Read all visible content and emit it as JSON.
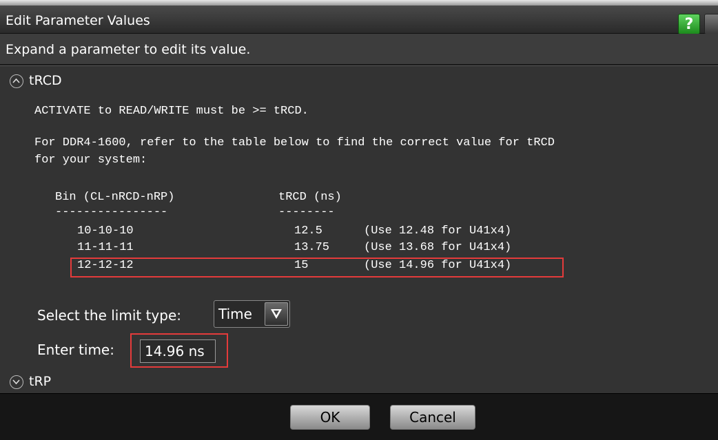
{
  "window": {
    "title": "Edit Parameter Values",
    "help_label": "?"
  },
  "instruction": "Expand a parameter to edit its value.",
  "params": [
    {
      "name": "tRCD",
      "expanded": true,
      "description_line1": "ACTIVATE to READ/WRITE must be >= tRCD.",
      "description_line2": "For DDR4-1600, refer to the table below to find the correct value for tRCD",
      "description_line3": "for your system:",
      "table": {
        "col1_header": "Bin (CL-nRCD-nRP)",
        "col2_header": "tRCD (ns)",
        "col1_rule": "----------------",
        "col2_rule": "--------",
        "rows": [
          {
            "bin": "10-10-10",
            "value": "12.5",
            "note": "(Use 12.48 for U41x4)"
          },
          {
            "bin": "11-11-11",
            "value": "13.75",
            "note": "(Use 13.68 for U41x4)"
          },
          {
            "bin": "12-12-12",
            "value": "15",
            "note": "(Use 14.96 for U41x4)"
          }
        ]
      },
      "limit_type_label": "Select the limit type:",
      "limit_type_value": "Time",
      "time_label": "Enter time:",
      "time_value": "14.96 ns"
    },
    {
      "name": "tRP",
      "expanded": false
    }
  ],
  "buttons": {
    "ok": "OK",
    "cancel": "Cancel"
  },
  "colors": {
    "highlight": "#e53b3b",
    "help_green": "#2fa52f"
  }
}
